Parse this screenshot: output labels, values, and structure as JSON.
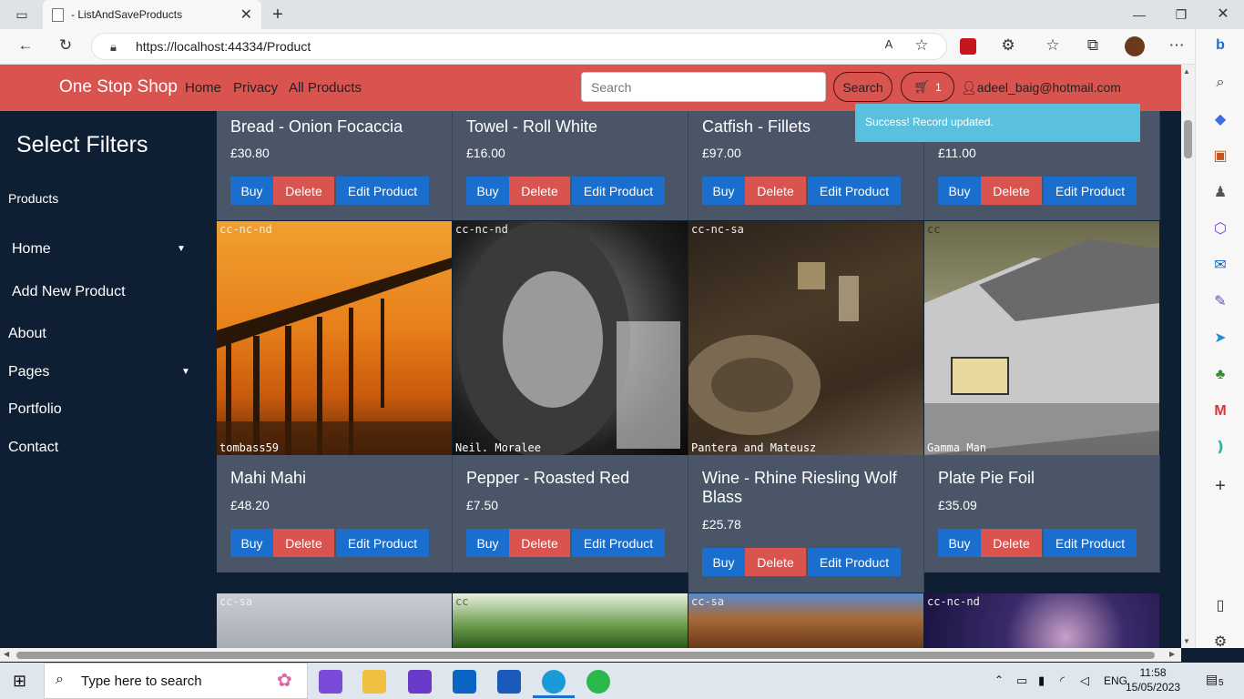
{
  "browser": {
    "tab_title": "- ListAndSaveProducts",
    "url": "https://localhost:44334/Product"
  },
  "navbar": {
    "brand": "One Stop Shop",
    "links": [
      "Home",
      "Privacy",
      "All Products"
    ],
    "search_placeholder": "Search",
    "search_button": "Search",
    "cart_count": "1",
    "user_email": "adeel_baig@hotmail.com"
  },
  "toast": {
    "message": "Success! Record updated."
  },
  "sidebar": {
    "title": "Select Filters",
    "section": "Products",
    "items": [
      "Home",
      "Add New Product",
      "About",
      "Pages",
      "Portfolio",
      "Contact"
    ]
  },
  "buttons": {
    "buy": "Buy",
    "delete": "Delete",
    "edit": "Edit Product"
  },
  "row1": [
    {
      "title": "Bread - Onion Focaccia",
      "price": "£30.80"
    },
    {
      "title": "Towel - Roll White",
      "price": "£16.00"
    },
    {
      "title": "Catfish - Fillets",
      "price": "£97.00"
    },
    {
      "title": "",
      "price": "£11.00"
    }
  ],
  "row2": [
    {
      "title": "Mahi Mahi",
      "price": "£48.20",
      "license": "cc-nc-nd",
      "credit": "tombass59"
    },
    {
      "title": "Pepper - Roasted Red",
      "price": "£7.50",
      "license": "cc-nc-nd",
      "credit": "Neil. Moralee"
    },
    {
      "title": "Wine - Rhine Riesling Wolf Blass",
      "price": "£25.78",
      "license": "cc-nc-sa",
      "credit": "Pantera and Mateusz"
    },
    {
      "title": "Plate Pie Foil",
      "price": "£35.09",
      "license": "cc",
      "credit": "Gamma Man"
    }
  ],
  "row3": [
    {
      "license": "cc-sa"
    },
    {
      "license": "cc"
    },
    {
      "license": "cc-sa"
    },
    {
      "license": "cc-nc-nd"
    }
  ],
  "taskbar": {
    "search_placeholder": "Type here to search",
    "language": "ENG",
    "time": "11:58",
    "date": "15/05/2023",
    "notifications": "5"
  }
}
